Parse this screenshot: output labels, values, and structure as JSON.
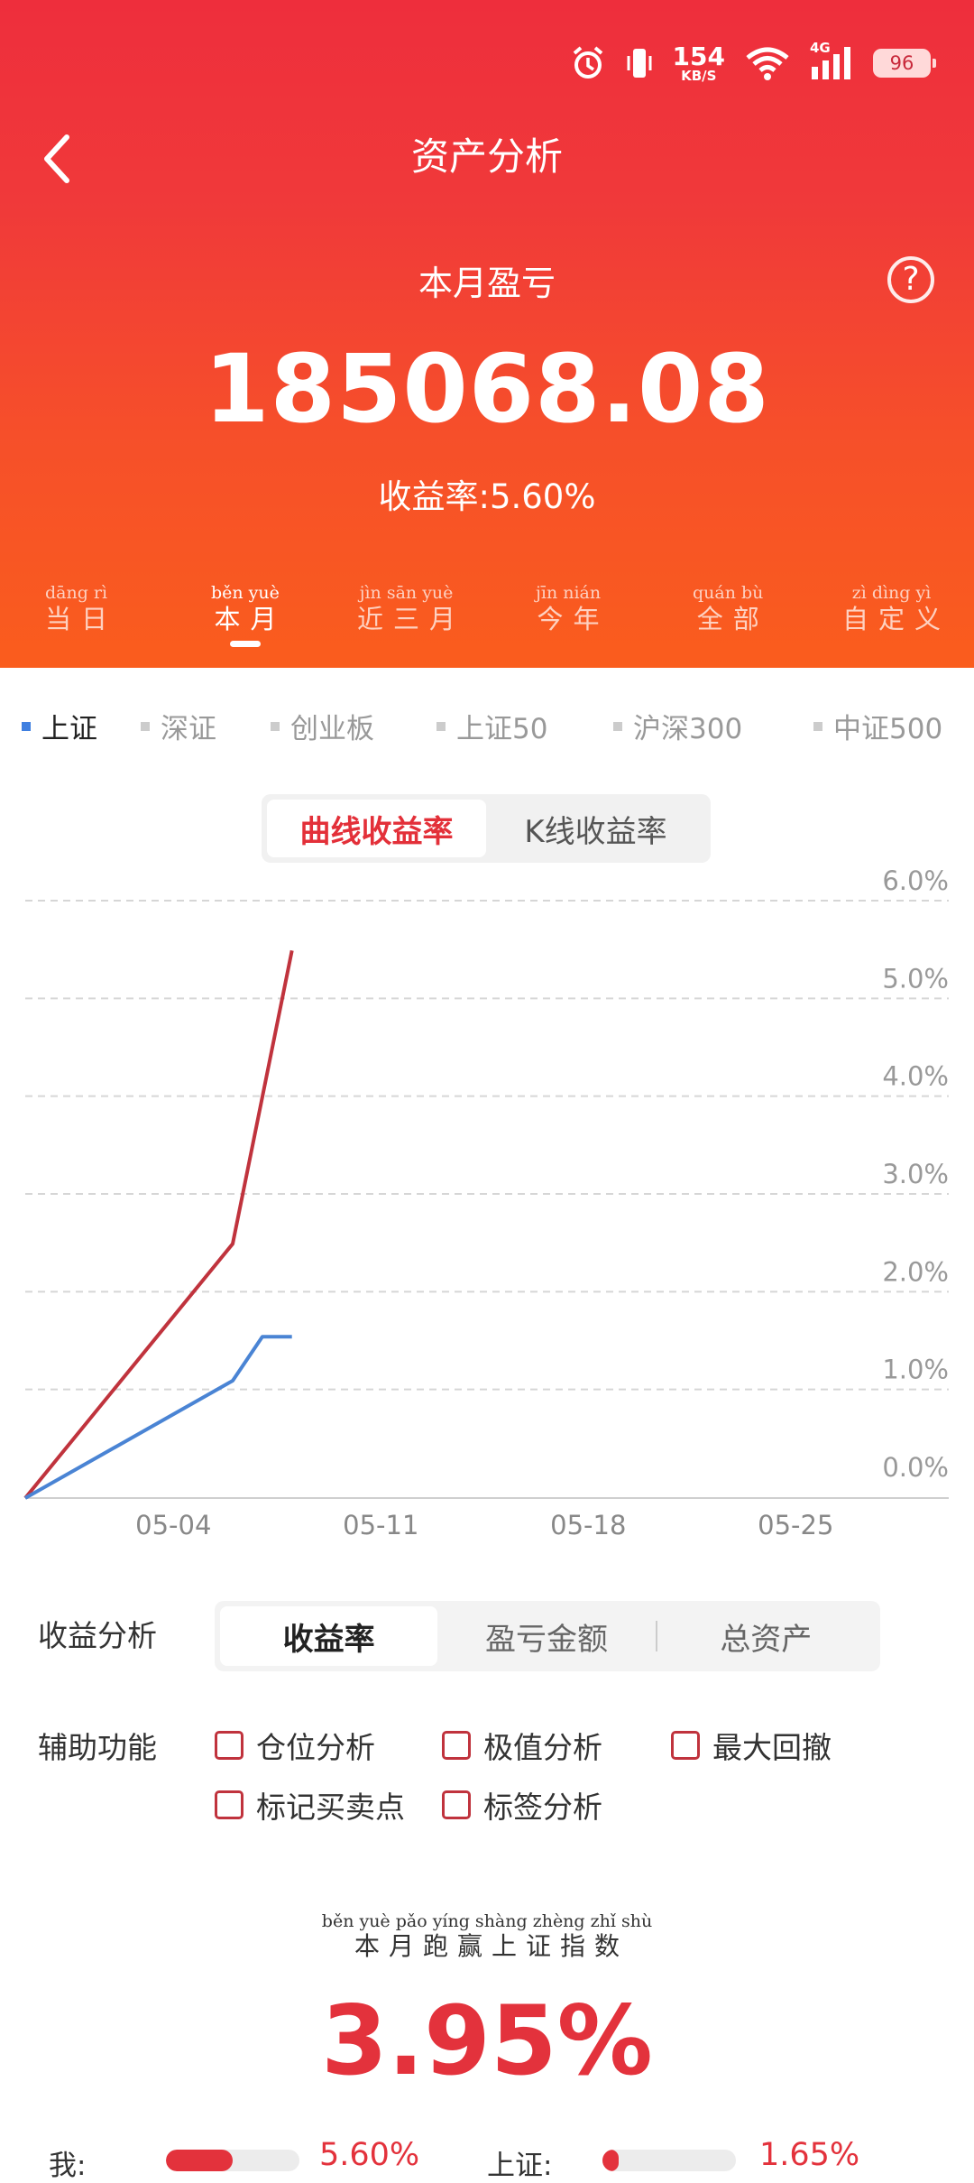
{
  "status_bar": {
    "net_speed": "154",
    "net_unit": "KB/S",
    "network": "4G",
    "battery": "96"
  },
  "header": {
    "title": "资产分析",
    "pl_label": "本月盈亏",
    "pl_amount": "185068.08",
    "yield_text": "收益率:5.60%"
  },
  "period_tabs": [
    {
      "pinyin": "dāng rì",
      "label": "当日"
    },
    {
      "pinyin": "běn yuè",
      "label": "本月",
      "active": true
    },
    {
      "pinyin": "jìn sān yuè",
      "label": "近三月"
    },
    {
      "pinyin": "jīn nián",
      "label": "今年"
    },
    {
      "pinyin": "quán bù",
      "label": "全部"
    },
    {
      "pinyin": "zì dìng yì",
      "label": "自定义"
    }
  ],
  "index_tabs": [
    {
      "label": "上证",
      "active": true
    },
    {
      "label": "深证"
    },
    {
      "label": "创业板"
    },
    {
      "label": "上证50"
    },
    {
      "label": "沪深300"
    },
    {
      "label": "中证500"
    }
  ],
  "curve_toggle": {
    "left": "曲线收益率",
    "right": "K线收益率",
    "selected": "left"
  },
  "chart_data": {
    "type": "line",
    "x_tick_labels": [
      "05-04",
      "05-11",
      "05-18",
      "05-25"
    ],
    "y_tick_labels": [
      "6.0%",
      "5.0%",
      "4.0%",
      "3.0%",
      "2.0%",
      "1.0%",
      "0.0%"
    ],
    "ylim": [
      0,
      6
    ],
    "grid": true,
    "series": [
      {
        "color": "#c0333d",
        "x": [
          "04-29",
          "05-06",
          "05-08"
        ],
        "y": [
          0.0,
          2.6,
          5.6
        ]
      },
      {
        "color": "#4a84d4",
        "x": [
          "04-29",
          "05-06",
          "05-07",
          "05-08"
        ],
        "y": [
          0.0,
          1.2,
          1.65,
          1.65
        ]
      }
    ]
  },
  "yield_analysis": {
    "label": "收益分析",
    "options": [
      "收益率",
      "盈亏金额",
      "总资产"
    ],
    "selected": 0
  },
  "aux": {
    "label": "辅助功能",
    "options": [
      "仓位分析",
      "极值分析",
      "最大回撤",
      "标记买卖点",
      "标签分析"
    ]
  },
  "beat": {
    "pinyin": "běn yuè pǎo yíng shàng zhèng zhǐ shù",
    "label": "本月跑赢上证指数",
    "value": "3.95%"
  },
  "comparison": {
    "me_label": "我:",
    "me_value": "5.60%",
    "me_fraction": 0.5,
    "index_label": "上证:",
    "index_value": "1.65%",
    "index_fraction": 0.12
  },
  "colors": {
    "header_top": "#ee2e3c",
    "header_bottom": "#fa5d1d",
    "accent_red": "#e3323c",
    "blue": "#3f7fe0"
  }
}
